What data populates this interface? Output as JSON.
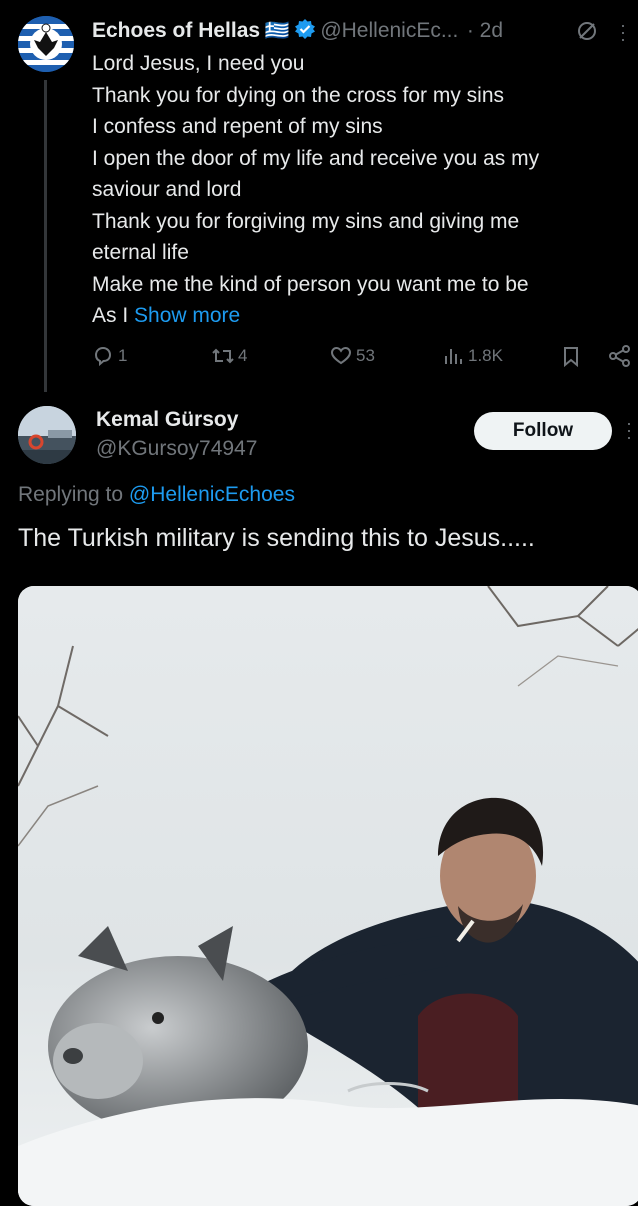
{
  "tweet": {
    "author_name": "Echoes of Hellas",
    "flag": "🇬🇷",
    "author_handle": "@HellenicEc...",
    "time": "· 2d",
    "lines": [
      "Lord Jesus, I need you",
      "Thank you for dying on the cross for my sins",
      "I confess and repent of my sins",
      "I open the door of my life and receive you as my",
      "saviour and lord",
      "Thank you for forgiving my sins and giving me",
      "eternal life",
      "Make me the kind of person you want me to be"
    ],
    "last_line_prefix": "As I ",
    "show_more": "Show more",
    "counts": {
      "replies": "1",
      "reposts": "4",
      "likes": "53",
      "views": "1.8K"
    }
  },
  "reply": {
    "author_name": "Kemal Gürsoy",
    "author_handle": "@KGursoy74947",
    "follow_label": "Follow",
    "replying_prefix": "Replying to ",
    "replying_handle": "@HellenicEchoes",
    "text": "The Turkish military is sending this to Jesus....."
  },
  "colors": {
    "background": "#000000",
    "text": "#e7e9ea",
    "muted": "#71767b",
    "link": "#1d9bf0",
    "verified": "#1d9bf0"
  },
  "icons": [
    "verified-badge-icon",
    "no-reply-icon",
    "reply-icon",
    "repost-icon",
    "like-icon",
    "views-icon",
    "bookmark-icon",
    "share-icon",
    "more-icon"
  ]
}
